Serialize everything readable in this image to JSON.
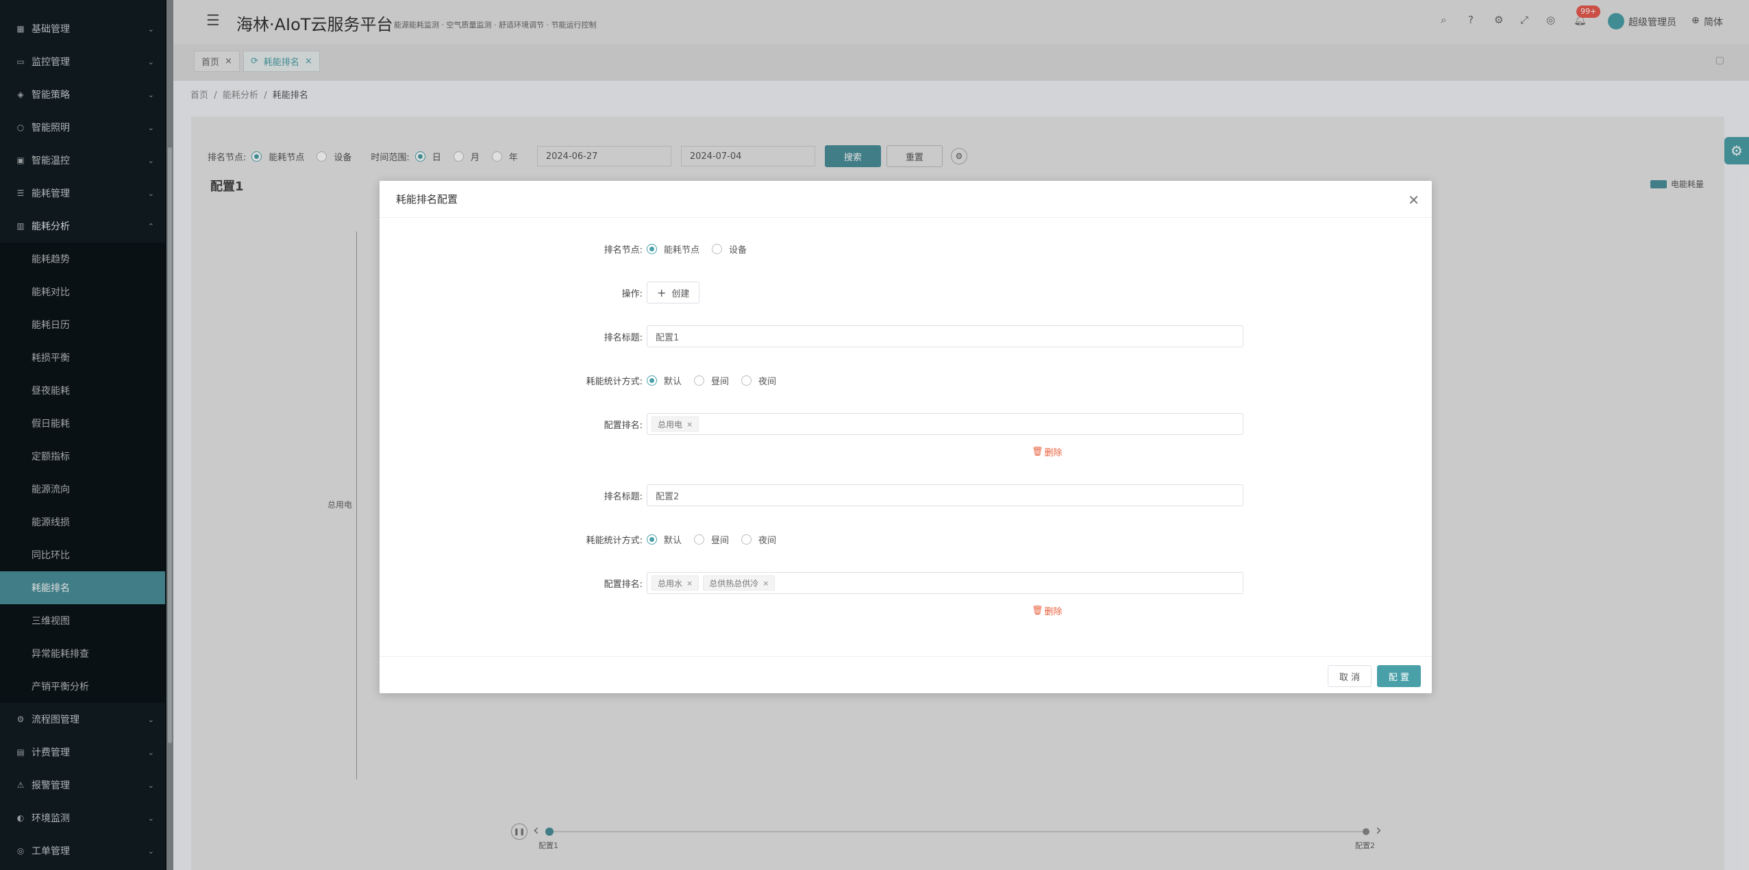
{
  "app": {
    "title": "海林·AIoT云服务平台",
    "subtitle": "能源能耗监测 · 空气质量监测 · 舒适环境调节 · 节能运行控制",
    "badge_count": "99+",
    "user": "超级管理员",
    "lang": "简体"
  },
  "sidebar": {
    "menus": [
      {
        "label": "基础管理",
        "icon": "grid-icon"
      },
      {
        "label": "监控管理",
        "icon": "monitor-icon"
      },
      {
        "label": "智能策略",
        "icon": "strategy-icon"
      },
      {
        "label": "智能照明",
        "icon": "bulb-icon"
      },
      {
        "label": "智能温控",
        "icon": "thermo-icon"
      },
      {
        "label": "能耗管理",
        "icon": "list-icon"
      },
      {
        "label": "能耗分析",
        "icon": "chart-icon"
      }
    ],
    "sub_items": [
      "能耗趋势",
      "能耗对比",
      "能耗日历",
      "耗损平衡",
      "昼夜能耗",
      "假日能耗",
      "定额指标",
      "能源流向",
      "能源线损",
      "同比环比",
      "耗能排名",
      "三维视图",
      "异常能耗排查",
      "产销平衡分析"
    ],
    "bottom_menus": [
      {
        "label": "流程图管理",
        "icon": "flow-icon"
      },
      {
        "label": "计费管理",
        "icon": "bill-icon"
      },
      {
        "label": "报警管理",
        "icon": "alarm-icon"
      },
      {
        "label": "环境监测",
        "icon": "env-icon"
      },
      {
        "label": "工单管理",
        "icon": "order-icon"
      }
    ]
  },
  "tabs": {
    "home": "首页",
    "current": "耗能排名"
  },
  "breadcrumb": {
    "home": "首页",
    "parent": "能耗分析",
    "current": "耗能排名"
  },
  "filter": {
    "node_label": "排名节点:",
    "node_opt1": "能耗节点",
    "node_opt2": "设备",
    "range_label": "时间范围:",
    "range_day": "日",
    "range_month": "月",
    "range_year": "年",
    "start_date": "2024-06-27",
    "end_date": "2024-07-04",
    "search": "搜索",
    "reset": "重置"
  },
  "chart": {
    "title": "配置1",
    "legend": "电能耗量",
    "ylabel": "总用电",
    "timeline1": "配置1",
    "timeline2": "配置2"
  },
  "dialog": {
    "title": "耗能排名配置",
    "node_label": "排名节点:",
    "node_opt1": "能耗节点",
    "node_opt2": "设备",
    "op_label": "操作:",
    "create": "创建",
    "title_label": "排名标题:",
    "stat_label": "耗能统计方式:",
    "stat_opt1": "默认",
    "stat_opt2": "昼间",
    "stat_opt3": "夜间",
    "config_label": "配置排名:",
    "delete": "删除",
    "cfg1_title": "配置1",
    "cfg1_tag1": "总用电",
    "cfg2_title": "配置2",
    "cfg2_tag1": "总用水",
    "cfg2_tag2": "总供热总供冷",
    "cancel": "取 消",
    "ok": "配 置"
  }
}
